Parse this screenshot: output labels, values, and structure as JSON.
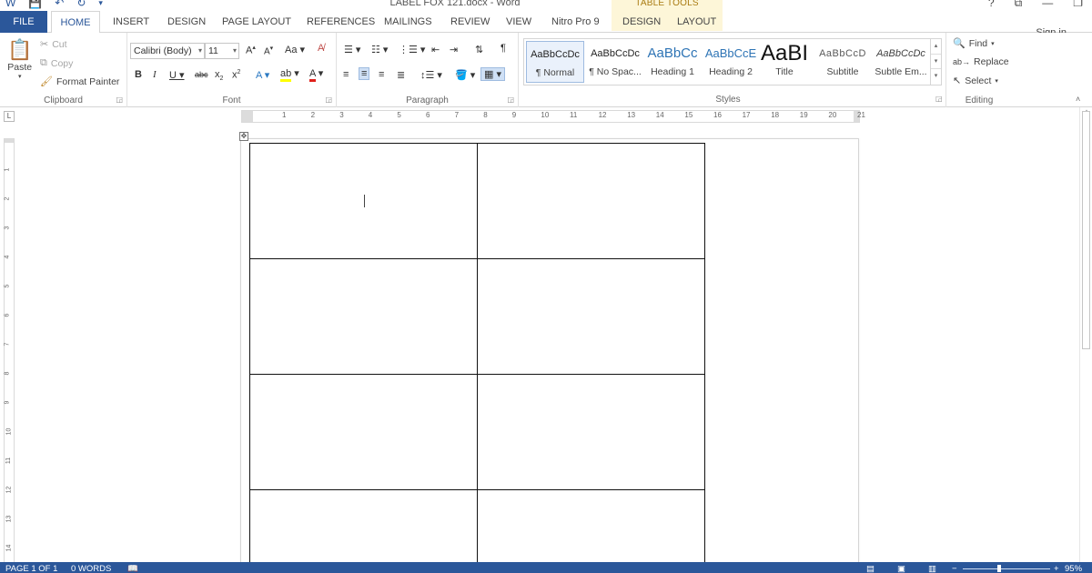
{
  "window": {
    "title": "LABEL FOX 121.docx - Word",
    "table_tools": "TABLE TOOLS",
    "sign_in": "Sign in",
    "controls": [
      "?",
      "⧉",
      "—",
      "❐"
    ]
  },
  "tabs": {
    "file": "FILE",
    "home": "HOME",
    "insert": "INSERT",
    "design": "DESIGN",
    "page_layout": "PAGE LAYOUT",
    "references": "REFERENCES",
    "mailings": "MAILINGS",
    "review": "REVIEW",
    "view": "VIEW",
    "nitro": "Nitro Pro 9",
    "tt_design": "DESIGN",
    "tt_layout": "LAYOUT"
  },
  "clipboard": {
    "paste": "Paste",
    "cut": "Cut",
    "copy": "Copy",
    "format_painter": "Format Painter",
    "group_label": "Clipboard"
  },
  "font": {
    "name": "Calibri (Body)",
    "size": "11",
    "group_label": "Font"
  },
  "paragraph": {
    "group_label": "Paragraph"
  },
  "styles": {
    "group_label": "Styles",
    "items": [
      {
        "sample": "AaBbCcDc",
        "label": "¶ Normal"
      },
      {
        "sample": "AaBbCcDc",
        "label": "¶ No Spac..."
      },
      {
        "sample": "AaBbCc",
        "label": "Heading 1"
      },
      {
        "sample": "AaBbCcE",
        "label": "Heading 2"
      },
      {
        "sample": "AaBI",
        "label": "Title"
      },
      {
        "sample": "AaBbCcD",
        "label": "Subtitle"
      },
      {
        "sample": "AaBbCcDc",
        "label": "Subtle Em..."
      }
    ]
  },
  "editing": {
    "find": "Find",
    "replace": "Replace",
    "select": "Select",
    "group_label": "Editing"
  },
  "ruler": {
    "h_numbers": [
      "1",
      "2",
      "3",
      "4",
      "5",
      "6",
      "7",
      "8",
      "9",
      "10",
      "11",
      "12",
      "13",
      "14",
      "15",
      "16",
      "17",
      "18",
      "19",
      "20",
      "21"
    ],
    "v_numbers": [
      "1",
      "2",
      "3",
      "4",
      "5",
      "6",
      "7",
      "8",
      "9",
      "10",
      "11",
      "12",
      "13",
      "14"
    ]
  },
  "statusbar": {
    "page": "PAGE 1 OF 1",
    "words": "0 WORDS",
    "zoom": "95%"
  },
  "colors": {
    "accent": "#2b579a",
    "table_tools": "#a97b12"
  }
}
